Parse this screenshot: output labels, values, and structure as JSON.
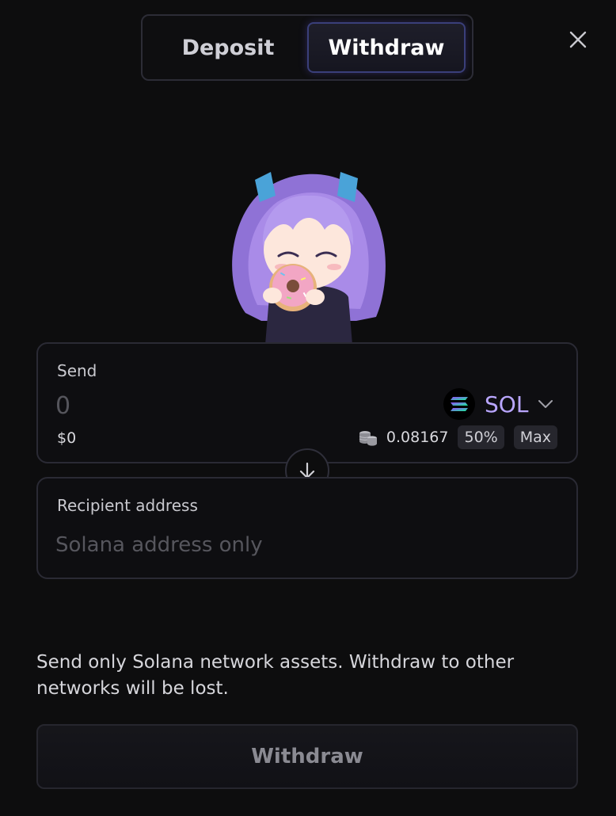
{
  "tabs": {
    "deposit": "Deposit",
    "withdraw": "Withdraw",
    "active": "withdraw"
  },
  "send": {
    "label": "Send",
    "amount_placeholder": "0",
    "usd_value": "$0",
    "token": "SOL",
    "balance": "0.08167",
    "half_label": "50%",
    "max_label": "Max"
  },
  "recipient": {
    "label": "Recipient address",
    "placeholder": "Solana address only"
  },
  "notice": "Send only Solana network assets. Withdraw to other networks will be lost.",
  "submit_label": "Withdraw",
  "icons": {
    "close": "close-icon",
    "token": "solana-logo-icon",
    "dropdown": "chevron-down-icon",
    "balance": "coins-icon",
    "swap": "arrow-down-icon",
    "mascot": "chibi-mascot-illustration"
  },
  "colors": {
    "background": "#0d0d0e",
    "accent": "#b9a6ff",
    "card_border": "#2a2a34"
  }
}
